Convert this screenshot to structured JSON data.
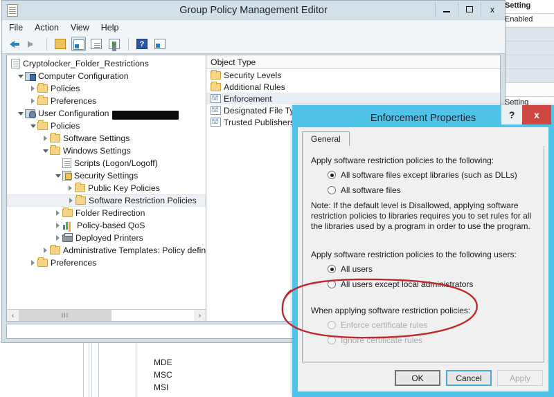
{
  "window": {
    "title": "Group Policy Management Editor",
    "icon": "console-document-icon",
    "controls": {
      "minimize": "–",
      "maximize": "□",
      "close": "x"
    },
    "menus": [
      "File",
      "Action",
      "View",
      "Help"
    ],
    "toolbar_icons": [
      "back-arrow-icon",
      "forward-arrow-icon",
      "up-folder-icon",
      "show-hide-console-tree-icon",
      "properties-icon",
      "export-list-icon",
      "help-icon",
      "show-hide-action-pane-icon"
    ]
  },
  "tree": {
    "root": {
      "label": "Cryptolocker_Folder_Restrictions",
      "redacted": true,
      "icon": "gpo-document-icon"
    },
    "items": [
      {
        "label": "Computer Configuration",
        "depth": 1,
        "state": "open",
        "icon": "computer-config-icon"
      },
      {
        "label": "Policies",
        "depth": 2,
        "state": "closed",
        "icon": "folder-icon"
      },
      {
        "label": "Preferences",
        "depth": 2,
        "state": "closed",
        "icon": "folder-icon"
      },
      {
        "label": "User Configuration",
        "depth": 1,
        "state": "open",
        "icon": "user-config-icon"
      },
      {
        "label": "Policies",
        "depth": 2,
        "state": "open",
        "icon": "folder-icon"
      },
      {
        "label": "Software Settings",
        "depth": 3,
        "state": "closed",
        "icon": "folder-icon"
      },
      {
        "label": "Windows Settings",
        "depth": 3,
        "state": "open",
        "icon": "folder-icon"
      },
      {
        "label": "Scripts (Logon/Logoff)",
        "depth": 4,
        "state": "leaf",
        "icon": "script-document-icon"
      },
      {
        "label": "Security Settings",
        "depth": 4,
        "state": "open",
        "icon": "security-settings-icon"
      },
      {
        "label": "Public Key Policies",
        "depth": 5,
        "state": "closed",
        "icon": "folder-icon"
      },
      {
        "label": "Software Restriction Policies",
        "depth": 5,
        "state": "closed",
        "icon": "folder-icon",
        "selected": true
      },
      {
        "label": "Folder Redirection",
        "depth": 4,
        "state": "closed",
        "icon": "folder-icon"
      },
      {
        "label": "Policy-based QoS",
        "depth": 4,
        "state": "closed",
        "icon": "qos-chart-icon"
      },
      {
        "label": "Deployed Printers",
        "depth": 4,
        "state": "closed",
        "icon": "printer-icon"
      },
      {
        "label": "Administrative Templates: Policy definitio",
        "depth": 3,
        "state": "closed",
        "icon": "folder-icon"
      },
      {
        "label": "Preferences",
        "depth": 2,
        "state": "closed",
        "icon": "folder-icon"
      }
    ]
  },
  "list": {
    "header": "Object Type",
    "rows": [
      {
        "label": "Security Levels",
        "icon": "folder-icon"
      },
      {
        "label": "Additional Rules",
        "icon": "folder-icon"
      },
      {
        "label": "Enforcement",
        "icon": "binary-settings-icon",
        "selected": true
      },
      {
        "label": "Designated File Types",
        "icon": "binary-settings-icon"
      },
      {
        "label": "Trusted Publishers",
        "icon": "binary-settings-icon"
      }
    ]
  },
  "scrollbar": {
    "left_arrow": "‹",
    "right_arrow": "›",
    "grip": "III"
  },
  "dialog": {
    "title": "Enforcement Properties",
    "help_label": "?",
    "close_label": "x",
    "tabs": [
      {
        "label": "General",
        "active": true
      }
    ],
    "section1": {
      "label": "Apply software restriction policies to the following:",
      "options": [
        {
          "label": "All software files except libraries (such as DLLs)",
          "selected": true,
          "disabled": false
        },
        {
          "label": "All software files",
          "selected": false,
          "disabled": false
        }
      ],
      "note": "Note:  If the default level is Disallowed, applying software restriction policies to libraries requires you to set rules for all the libraries used by a program in order to use the program."
    },
    "section2": {
      "label": "Apply software restriction policies to the following users:",
      "options": [
        {
          "label": "All users",
          "selected": true,
          "disabled": false
        },
        {
          "label": "All users except local administrators",
          "selected": false,
          "disabled": false
        }
      ]
    },
    "section3": {
      "label": "When applying software restriction policies:",
      "options": [
        {
          "label": "Enforce certificate rules",
          "selected": false,
          "disabled": true
        },
        {
          "label": "Ignore certificate rules",
          "selected": false,
          "disabled": true
        }
      ]
    },
    "buttons": [
      {
        "label": "OK",
        "style": "default",
        "disabled": false
      },
      {
        "label": "Cancel",
        "style": "focus",
        "disabled": false
      },
      {
        "label": "Apply",
        "style": "plain",
        "disabled": true
      }
    ]
  },
  "annotation": {
    "shape": "red-ellipse",
    "color": "#c1272d",
    "targets": "section3"
  },
  "background_right": {
    "rows": [
      {
        "label": "Setting",
        "bold": true,
        "shade": false
      },
      {
        "label": "Enabled",
        "bold": false,
        "shade": false
      },
      {
        "label": "",
        "bold": false,
        "shade": true
      },
      {
        "label": "",
        "bold": false,
        "shade": true
      },
      {
        "label": "",
        "bold": false,
        "shade": true
      },
      {
        "label": "",
        "bold": false,
        "shade": true
      },
      {
        "label": "",
        "bold": false,
        "shade": false
      },
      {
        "label": "Setting",
        "bold": false,
        "shade": false
      }
    ]
  },
  "background_bottom": {
    "items": [
      "MDE",
      "MSC",
      "MSI"
    ]
  },
  "colors": {
    "dialog_border": "#4fc3e8",
    "close_button": "#cf4742",
    "annotation_red": "#c1272d",
    "titlebar": "#d4e0e8",
    "selection": "#e8eef3"
  }
}
